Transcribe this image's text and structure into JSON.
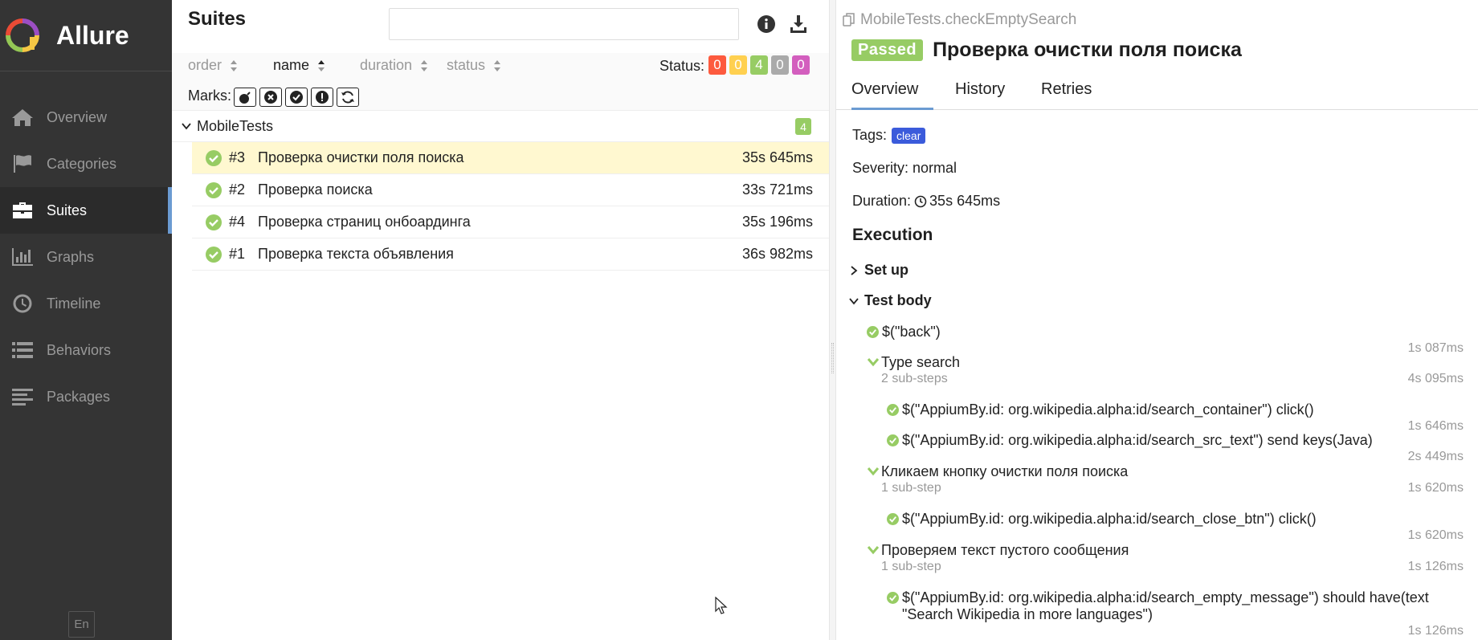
{
  "app": {
    "name": "Allure",
    "lang_label": "En"
  },
  "colors": {
    "sidebar_bg": "#343434",
    "accent": "#6b9bd2",
    "passed": "#97cc64",
    "failed": "#fd5a3e",
    "broken": "#ffd050",
    "skipped": "#aaaaaa",
    "unknown": "#d35ebe",
    "tag": "#3b5bdb",
    "selected_row": "#fff8d0"
  },
  "nav": [
    {
      "label": "Overview",
      "icon": "home-icon"
    },
    {
      "label": "Categories",
      "icon": "flag-icon"
    },
    {
      "label": "Suites",
      "icon": "briefcase-icon",
      "active": true
    },
    {
      "label": "Graphs",
      "icon": "bar-chart-icon"
    },
    {
      "label": "Timeline",
      "icon": "clock-icon"
    },
    {
      "label": "Behaviors",
      "icon": "list-icon"
    },
    {
      "label": "Packages",
      "icon": "align-left-icon"
    }
  ],
  "suites": {
    "title": "Suites",
    "search_value": "",
    "sort": [
      "order",
      "name",
      "duration",
      "status"
    ],
    "status_label": "Status:",
    "status_counts": [
      "0",
      "0",
      "4",
      "0",
      "0"
    ],
    "marks_label": "Marks:",
    "group": {
      "name": "MobileTests",
      "count": "4"
    },
    "tests": [
      {
        "num": "#3",
        "name": "Проверка очистки поля поиска",
        "duration": "35s 645ms"
      },
      {
        "num": "#2",
        "name": "Проверка поиска",
        "duration": "33s 721ms"
      },
      {
        "num": "#4",
        "name": "Проверка страниц онбоардинга",
        "duration": "35s 196ms"
      },
      {
        "num": "#1",
        "name": "Проверка текста объявления",
        "duration": "36s 982ms"
      }
    ]
  },
  "details": {
    "fullname": "MobileTests.checkEmptySearch",
    "status": "Passed",
    "title": "Проверка очистки поля поиска",
    "tabs": [
      "Overview",
      "History",
      "Retries"
    ],
    "tags_label": "Tags:",
    "tag": "clear",
    "severity": "Severity: normal",
    "duration_label": "Duration:",
    "duration": "35s 645ms",
    "execution": "Execution",
    "setup": "Set up",
    "body": "Test body",
    "steps": {
      "back": "$(\"back\")",
      "back_dur": "1s 087ms",
      "type_search": "Type search",
      "type_search_sub": "2 sub-steps",
      "type_search_dur": "4s 095ms",
      "click_container": "$(\"AppiumBy.id: org.wikipedia.alpha:id/search_container\") click()",
      "click_container_dur": "1s 646ms",
      "send_keys": "$(\"AppiumBy.id: org.wikipedia.alpha:id/search_src_text\") send keys(Java)",
      "send_keys_dur": "2s 449ms",
      "click_clear": "Кликаем кнопку очистки поля поиска",
      "click_clear_sub": "1 sub-step",
      "click_clear_dur": "1s 620ms",
      "close_btn": "$(\"AppiumBy.id: org.wikipedia.alpha:id/search_close_btn\") click()",
      "close_btn_dur": "1s 620ms",
      "check_empty": "Проверяем текст пустого сообщения",
      "check_empty_sub": "1 sub-step",
      "check_empty_dur": "1s 126ms",
      "empty_msg_line1": "$(\"AppiumBy.id: org.wikipedia.alpha:id/search_empty_message\") should have(text",
      "empty_msg_line2": "\"Search Wikipedia in more languages\")",
      "empty_msg_dur": "1s 126ms"
    }
  }
}
